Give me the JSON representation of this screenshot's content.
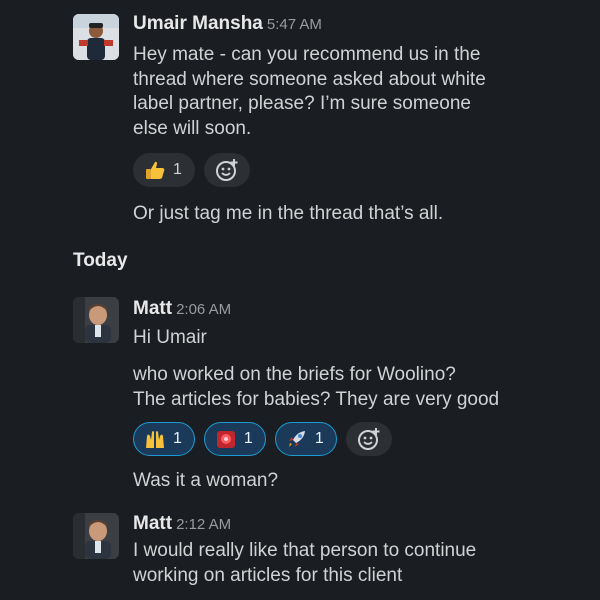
{
  "messages": [
    {
      "author": "Umair Mansha",
      "time": "5:47 AM",
      "lines": [
        "Hey mate - can you recommend us in the",
        "thread where someone asked about white",
        "label partner, please? I’m sure someone",
        "else will soon."
      ],
      "reactions": [
        {
          "emoji": "thumbs-up",
          "count": "1"
        }
      ],
      "followup": "Or just tag me in the thread that’s all."
    },
    {
      "divider": "Today"
    },
    {
      "author": "Matt",
      "time": "2:06 AM",
      "text1": "Hi Umair",
      "lines": [
        "who worked on the briefs for Woolino?",
        "The articles for babies? They are very good"
      ],
      "reactions": [
        {
          "emoji": "raised-hands",
          "count": "1"
        },
        {
          "emoji": "rotating-light",
          "count": "1"
        },
        {
          "emoji": "rocket",
          "count": "1"
        }
      ],
      "followup": "Was it a woman?"
    },
    {
      "author": "Matt",
      "time": "2:12 AM",
      "lines": [
        "I would really like that person to continue",
        "working on articles for this client"
      ]
    }
  ],
  "colors": {
    "background": "#1a1d21",
    "text": "#d1d2d3",
    "active_reaction_bg": "#1b3a5a",
    "active_reaction_border": "#1d9bd1"
  }
}
